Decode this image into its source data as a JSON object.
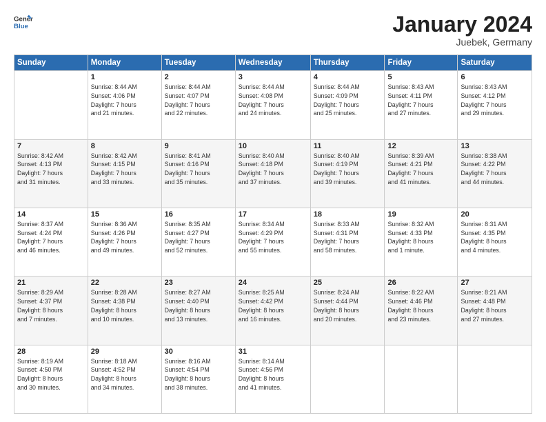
{
  "header": {
    "logo_line1": "General",
    "logo_line2": "Blue",
    "title": "January 2024",
    "subtitle": "Juebek, Germany"
  },
  "days_of_week": [
    "Sunday",
    "Monday",
    "Tuesday",
    "Wednesday",
    "Thursday",
    "Friday",
    "Saturday"
  ],
  "weeks": [
    [
      {
        "day": "",
        "info": ""
      },
      {
        "day": "1",
        "info": "Sunrise: 8:44 AM\nSunset: 4:06 PM\nDaylight: 7 hours\nand 21 minutes."
      },
      {
        "day": "2",
        "info": "Sunrise: 8:44 AM\nSunset: 4:07 PM\nDaylight: 7 hours\nand 22 minutes."
      },
      {
        "day": "3",
        "info": "Sunrise: 8:44 AM\nSunset: 4:08 PM\nDaylight: 7 hours\nand 24 minutes."
      },
      {
        "day": "4",
        "info": "Sunrise: 8:44 AM\nSunset: 4:09 PM\nDaylight: 7 hours\nand 25 minutes."
      },
      {
        "day": "5",
        "info": "Sunrise: 8:43 AM\nSunset: 4:11 PM\nDaylight: 7 hours\nand 27 minutes."
      },
      {
        "day": "6",
        "info": "Sunrise: 8:43 AM\nSunset: 4:12 PM\nDaylight: 7 hours\nand 29 minutes."
      }
    ],
    [
      {
        "day": "7",
        "info": "Sunrise: 8:42 AM\nSunset: 4:13 PM\nDaylight: 7 hours\nand 31 minutes."
      },
      {
        "day": "8",
        "info": "Sunrise: 8:42 AM\nSunset: 4:15 PM\nDaylight: 7 hours\nand 33 minutes."
      },
      {
        "day": "9",
        "info": "Sunrise: 8:41 AM\nSunset: 4:16 PM\nDaylight: 7 hours\nand 35 minutes."
      },
      {
        "day": "10",
        "info": "Sunrise: 8:40 AM\nSunset: 4:18 PM\nDaylight: 7 hours\nand 37 minutes."
      },
      {
        "day": "11",
        "info": "Sunrise: 8:40 AM\nSunset: 4:19 PM\nDaylight: 7 hours\nand 39 minutes."
      },
      {
        "day": "12",
        "info": "Sunrise: 8:39 AM\nSunset: 4:21 PM\nDaylight: 7 hours\nand 41 minutes."
      },
      {
        "day": "13",
        "info": "Sunrise: 8:38 AM\nSunset: 4:22 PM\nDaylight: 7 hours\nand 44 minutes."
      }
    ],
    [
      {
        "day": "14",
        "info": "Sunrise: 8:37 AM\nSunset: 4:24 PM\nDaylight: 7 hours\nand 46 minutes."
      },
      {
        "day": "15",
        "info": "Sunrise: 8:36 AM\nSunset: 4:26 PM\nDaylight: 7 hours\nand 49 minutes."
      },
      {
        "day": "16",
        "info": "Sunrise: 8:35 AM\nSunset: 4:27 PM\nDaylight: 7 hours\nand 52 minutes."
      },
      {
        "day": "17",
        "info": "Sunrise: 8:34 AM\nSunset: 4:29 PM\nDaylight: 7 hours\nand 55 minutes."
      },
      {
        "day": "18",
        "info": "Sunrise: 8:33 AM\nSunset: 4:31 PM\nDaylight: 7 hours\nand 58 minutes."
      },
      {
        "day": "19",
        "info": "Sunrise: 8:32 AM\nSunset: 4:33 PM\nDaylight: 8 hours\nand 1 minute."
      },
      {
        "day": "20",
        "info": "Sunrise: 8:31 AM\nSunset: 4:35 PM\nDaylight: 8 hours\nand 4 minutes."
      }
    ],
    [
      {
        "day": "21",
        "info": "Sunrise: 8:29 AM\nSunset: 4:37 PM\nDaylight: 8 hours\nand 7 minutes."
      },
      {
        "day": "22",
        "info": "Sunrise: 8:28 AM\nSunset: 4:38 PM\nDaylight: 8 hours\nand 10 minutes."
      },
      {
        "day": "23",
        "info": "Sunrise: 8:27 AM\nSunset: 4:40 PM\nDaylight: 8 hours\nand 13 minutes."
      },
      {
        "day": "24",
        "info": "Sunrise: 8:25 AM\nSunset: 4:42 PM\nDaylight: 8 hours\nand 16 minutes."
      },
      {
        "day": "25",
        "info": "Sunrise: 8:24 AM\nSunset: 4:44 PM\nDaylight: 8 hours\nand 20 minutes."
      },
      {
        "day": "26",
        "info": "Sunrise: 8:22 AM\nSunset: 4:46 PM\nDaylight: 8 hours\nand 23 minutes."
      },
      {
        "day": "27",
        "info": "Sunrise: 8:21 AM\nSunset: 4:48 PM\nDaylight: 8 hours\nand 27 minutes."
      }
    ],
    [
      {
        "day": "28",
        "info": "Sunrise: 8:19 AM\nSunset: 4:50 PM\nDaylight: 8 hours\nand 30 minutes."
      },
      {
        "day": "29",
        "info": "Sunrise: 8:18 AM\nSunset: 4:52 PM\nDaylight: 8 hours\nand 34 minutes."
      },
      {
        "day": "30",
        "info": "Sunrise: 8:16 AM\nSunset: 4:54 PM\nDaylight: 8 hours\nand 38 minutes."
      },
      {
        "day": "31",
        "info": "Sunrise: 8:14 AM\nSunset: 4:56 PM\nDaylight: 8 hours\nand 41 minutes."
      },
      {
        "day": "",
        "info": ""
      },
      {
        "day": "",
        "info": ""
      },
      {
        "day": "",
        "info": ""
      }
    ]
  ]
}
